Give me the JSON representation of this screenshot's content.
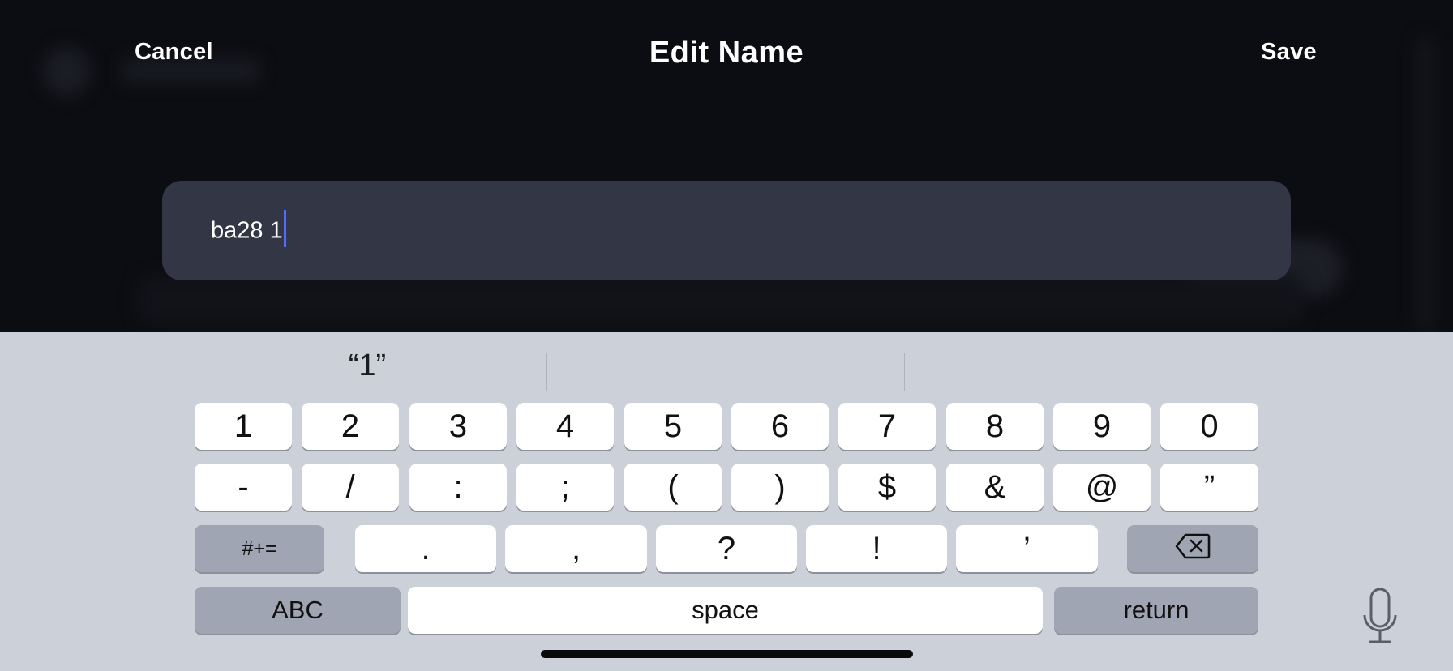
{
  "header": {
    "cancel_label": "Cancel",
    "title": "Edit Name",
    "save_label": "Save"
  },
  "name_field": {
    "value": "ba28 1"
  },
  "keyboard": {
    "suggestions": [
      "“1”",
      "",
      ""
    ],
    "row1": [
      "1",
      "2",
      "3",
      "4",
      "5",
      "6",
      "7",
      "8",
      "9",
      "0"
    ],
    "row2": [
      "-",
      "/",
      ":",
      ";",
      "(",
      ")",
      "$",
      "&",
      "@",
      "”"
    ],
    "symbols_toggle": "#+=",
    "row3": [
      ".",
      ",",
      "?",
      "!",
      "’"
    ],
    "backspace_icon": "backspace-icon",
    "abc_label": "ABC",
    "space_label": "space",
    "return_label": "return",
    "mic_icon": "microphone-icon"
  },
  "colors": {
    "background": "#0c0d12",
    "field_background": "#333644",
    "caret": "#4f6cff",
    "keyboard_background": "#ccd0d8",
    "key_background": "#ffffff",
    "function_key_background": "#9fa5b2"
  }
}
